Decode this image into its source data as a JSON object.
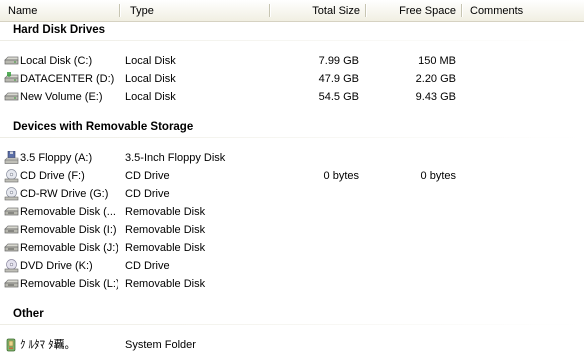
{
  "columns": {
    "name": "Name",
    "type": "Type",
    "total_size": "Total Size",
    "free_space": "Free Space",
    "comments": "Comments"
  },
  "groups": {
    "hdd": {
      "title": "Hard Disk Drives",
      "items": [
        {
          "name": "Local Disk (C:)",
          "type": "Local Disk",
          "total": "7.99 GB",
          "free": "150 MB",
          "icon": "hard-disk-icon"
        },
        {
          "name": "DATACENTER (D:)",
          "type": "Local Disk",
          "total": "47.9 GB",
          "free": "2.20 GB",
          "icon": "hard-disk-icon"
        },
        {
          "name": "New Volume (E:)",
          "type": "Local Disk",
          "total": "54.5 GB",
          "free": "9.43 GB",
          "icon": "hard-disk-icon"
        }
      ]
    },
    "removable": {
      "title": "Devices with Removable Storage",
      "items": [
        {
          "name": "3.5 Floppy (A:)",
          "type": "3.5-Inch Floppy Disk",
          "total": "",
          "free": "",
          "icon": "floppy-drive-icon"
        },
        {
          "name": "CD Drive (F:)",
          "type": "CD Drive",
          "total": "0 bytes",
          "free": "0 bytes",
          "icon": "cd-drive-icon"
        },
        {
          "name": "CD-RW Drive (G:)",
          "type": "CD Drive",
          "total": "",
          "free": "",
          "icon": "cd-drive-icon"
        },
        {
          "name": "Removable Disk (...",
          "type": "Removable Disk",
          "total": "",
          "free": "",
          "icon": "removable-disk-icon"
        },
        {
          "name": "Removable Disk (I:)",
          "type": "Removable Disk",
          "total": "",
          "free": "",
          "icon": "removable-disk-icon"
        },
        {
          "name": "Removable Disk (J:)",
          "type": "Removable Disk",
          "total": "",
          "free": "",
          "icon": "removable-disk-icon"
        },
        {
          "name": "DVD Drive (K:)",
          "type": "CD Drive",
          "total": "",
          "free": "",
          "icon": "dvd-drive-icon"
        },
        {
          "name": "Removable Disk (L:)",
          "type": "Removable Disk",
          "total": "",
          "free": "",
          "icon": "removable-disk-icon"
        }
      ]
    },
    "other": {
      "title": "Other",
      "items": [
        {
          "name": "ｸ ﾙﾀﾏ ﾀ覊｡",
          "type": "System Folder",
          "total": "",
          "free": "",
          "icon": "system-folder-icon"
        }
      ]
    }
  }
}
